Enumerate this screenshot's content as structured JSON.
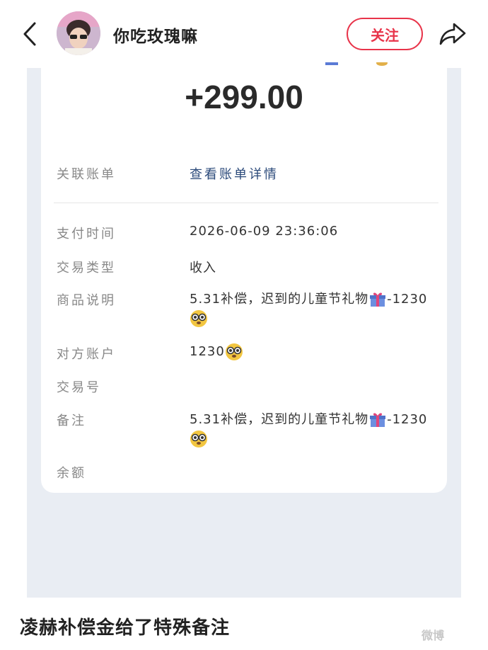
{
  "header": {
    "username": "你吃玫瑰嘛",
    "follow_label": "关注"
  },
  "receipt": {
    "amount": "+299.00",
    "linked_bill_label": "关联账单",
    "linked_bill_value": "查看账单详情",
    "pay_time_label": "支付时间",
    "pay_time_value": "2026-06-09 23:36:06",
    "trade_type_label": "交易类型",
    "trade_type_value": "收入",
    "goods_desc_label": "商品说明",
    "goods_desc_value": "5.31补偿，迟到的儿童节礼物",
    "goods_desc_suffix": "-1230",
    "counterparty_label": "对方账户",
    "counterparty_value": "1230",
    "trade_no_label": "交易号",
    "remark_label": "备注",
    "remark_value": "5.31补偿，迟到的儿童节礼物",
    "remark_suffix": "-1230",
    "balance_label": "余额"
  },
  "post": {
    "caption": "凌赫补偿金给了特殊备注",
    "watermark": "微博"
  },
  "icons": {
    "back": "chevron-left-icon",
    "share": "share-arrow-icon",
    "gift": "gift-emoji",
    "face": "glasses-face-emoji"
  },
  "colors": {
    "accent": "#e8344a",
    "link": "#2b4a7a",
    "background": "#e9edf3"
  }
}
